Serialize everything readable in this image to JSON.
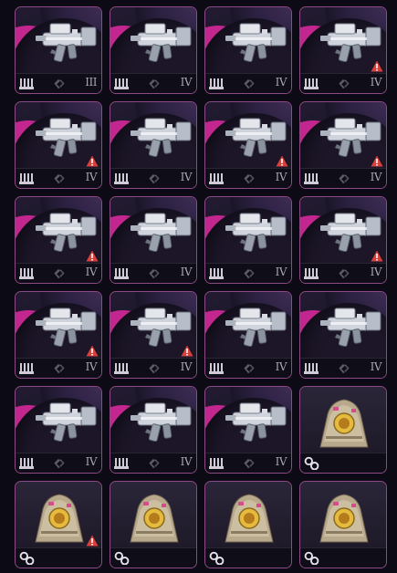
{
  "inventory": {
    "slots": [
      {
        "type": "weapon",
        "item": "smg",
        "tier": "III",
        "warning": false
      },
      {
        "type": "weapon",
        "item": "smg",
        "tier": "IV",
        "warning": false
      },
      {
        "type": "weapon",
        "item": "smg",
        "tier": "IV",
        "warning": false
      },
      {
        "type": "weapon",
        "item": "smg",
        "tier": "IV",
        "warning": true
      },
      {
        "type": "weapon",
        "item": "smg",
        "tier": "IV",
        "warning": true
      },
      {
        "type": "weapon",
        "item": "smg",
        "tier": "IV",
        "warning": false
      },
      {
        "type": "weapon",
        "item": "smg",
        "tier": "IV",
        "warning": true
      },
      {
        "type": "weapon",
        "item": "smg",
        "tier": "IV",
        "warning": true
      },
      {
        "type": "weapon",
        "item": "smg",
        "tier": "IV",
        "warning": true
      },
      {
        "type": "weapon",
        "item": "smg",
        "tier": "IV",
        "warning": false
      },
      {
        "type": "weapon",
        "item": "smg",
        "tier": "IV",
        "warning": false
      },
      {
        "type": "weapon",
        "item": "smg",
        "tier": "IV",
        "warning": true
      },
      {
        "type": "weapon",
        "item": "smg",
        "tier": "IV",
        "warning": true
      },
      {
        "type": "weapon",
        "item": "smg",
        "tier": "IV",
        "warning": true
      },
      {
        "type": "weapon",
        "item": "smg",
        "tier": "IV",
        "warning": false
      },
      {
        "type": "weapon",
        "item": "smg",
        "tier": "IV",
        "warning": false
      },
      {
        "type": "weapon",
        "item": "smg",
        "tier": "IV",
        "warning": false
      },
      {
        "type": "weapon",
        "item": "smg",
        "tier": "IV",
        "warning": false
      },
      {
        "type": "weapon",
        "item": "smg",
        "tier": "IV",
        "warning": false
      },
      {
        "type": "gear",
        "item": "armor-plate-pack",
        "warning": false
      },
      {
        "type": "gear",
        "item": "armor-plate-pack",
        "warning": true
      },
      {
        "type": "gear",
        "item": "armor-plate-pack",
        "warning": false
      },
      {
        "type": "gear",
        "item": "armor-plate-pack",
        "warning": false
      },
      {
        "type": "gear",
        "item": "armor-plate-pack",
        "warning": false
      }
    ]
  },
  "colors": {
    "rarity_accent": "#c3268f",
    "slot_border": "#8e4a86",
    "warning": "#d9403a",
    "background": "#0c0b15"
  },
  "icons": {
    "magazine": "magazine-icon",
    "mod": "mod-slot-icon",
    "attachment": "attachment-icon",
    "warning": "warning-icon"
  }
}
